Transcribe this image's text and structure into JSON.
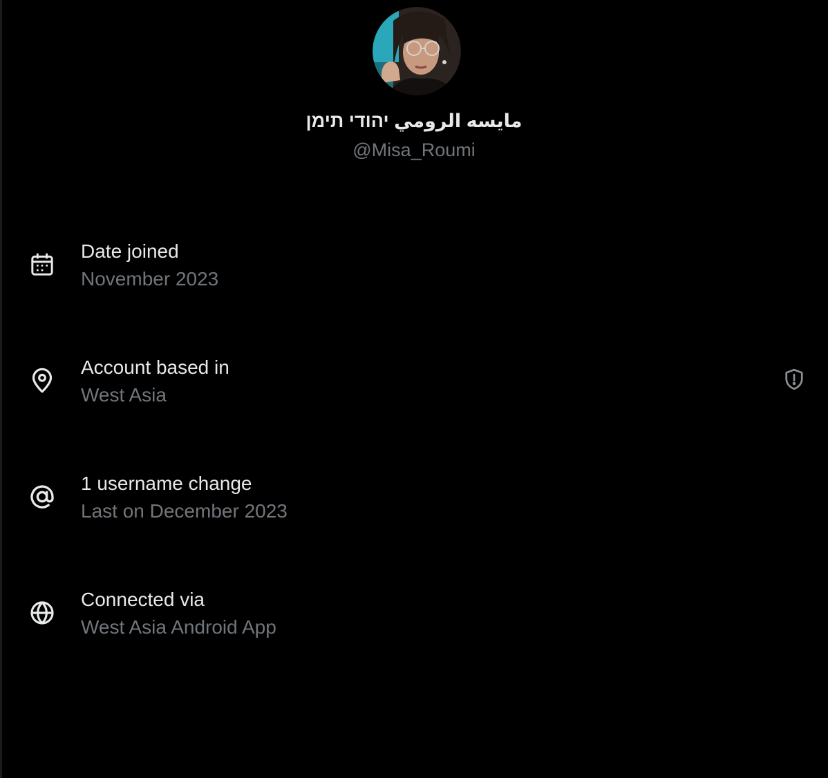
{
  "profile": {
    "display_name": "مايسه الرومي יהודי תימן",
    "handle": "@Misa_Roumi"
  },
  "info": [
    {
      "icon": "calendar-icon",
      "label": "Date joined",
      "value": "November 2023"
    },
    {
      "icon": "location-pin-icon",
      "label": "Account based in",
      "value": "West Asia",
      "badge_icon": "shield-alert-icon"
    },
    {
      "icon": "at-sign-icon",
      "label": "1 username change",
      "value": "Last on December 2023"
    },
    {
      "icon": "globe-icon",
      "label": "Connected via",
      "value": "West Asia Android App"
    }
  ],
  "colors": {
    "background": "#000000",
    "primary_text": "#e7e9ea",
    "secondary_text": "#71767b"
  }
}
